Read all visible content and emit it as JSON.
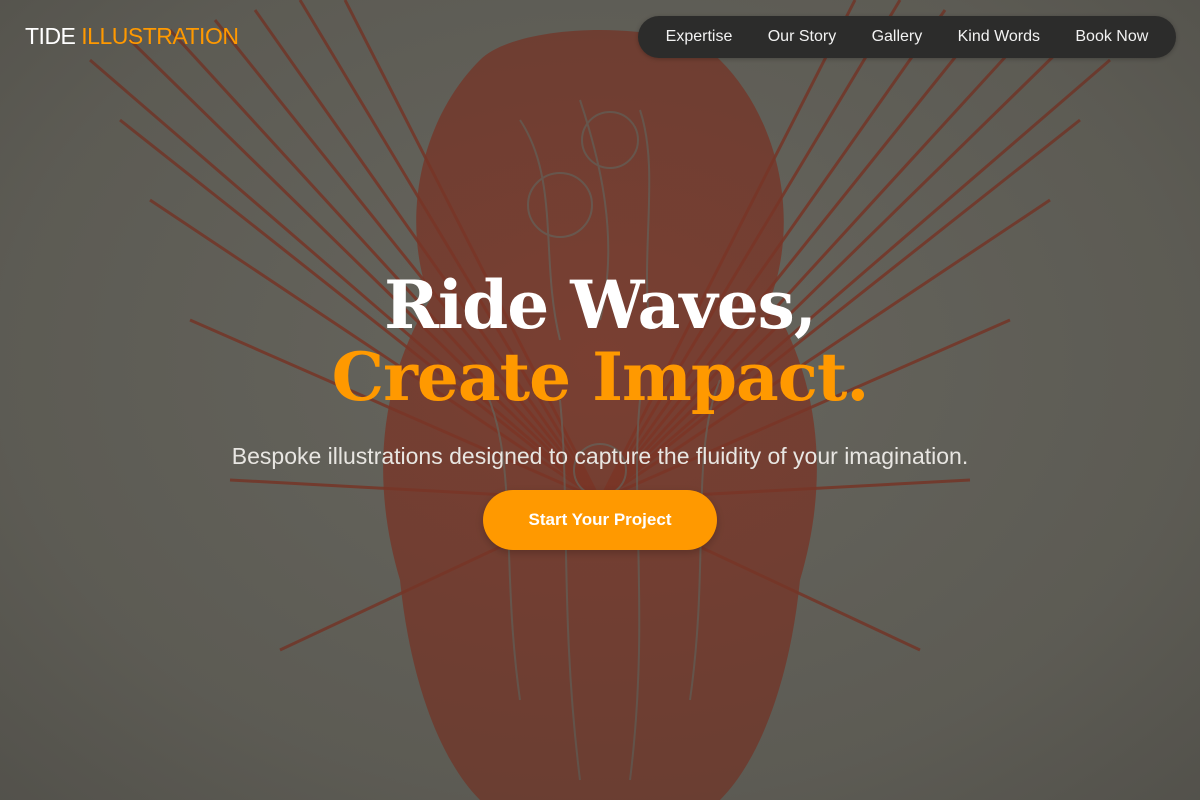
{
  "brand": {
    "name_part1": "TIDE",
    "name_part2": "ILLUSTRATION",
    "accent_color": "#ff9900"
  },
  "nav": {
    "items": [
      {
        "label": "Expertise"
      },
      {
        "label": "Our Story"
      },
      {
        "label": "Gallery"
      },
      {
        "label": "Kind Words"
      },
      {
        "label": "Book Now"
      }
    ]
  },
  "hero": {
    "headline_line1": "Ride Waves,",
    "headline_line2": "Create Impact.",
    "subtitle": "Bespoke illustrations designed to capture the fluidity of your imagination.",
    "cta_label": "Start Your Project",
    "background_image": "red line engraving of winged angelic figures on grey paper",
    "line_color": "#8a3322",
    "paper_color": "#6b6a62"
  }
}
